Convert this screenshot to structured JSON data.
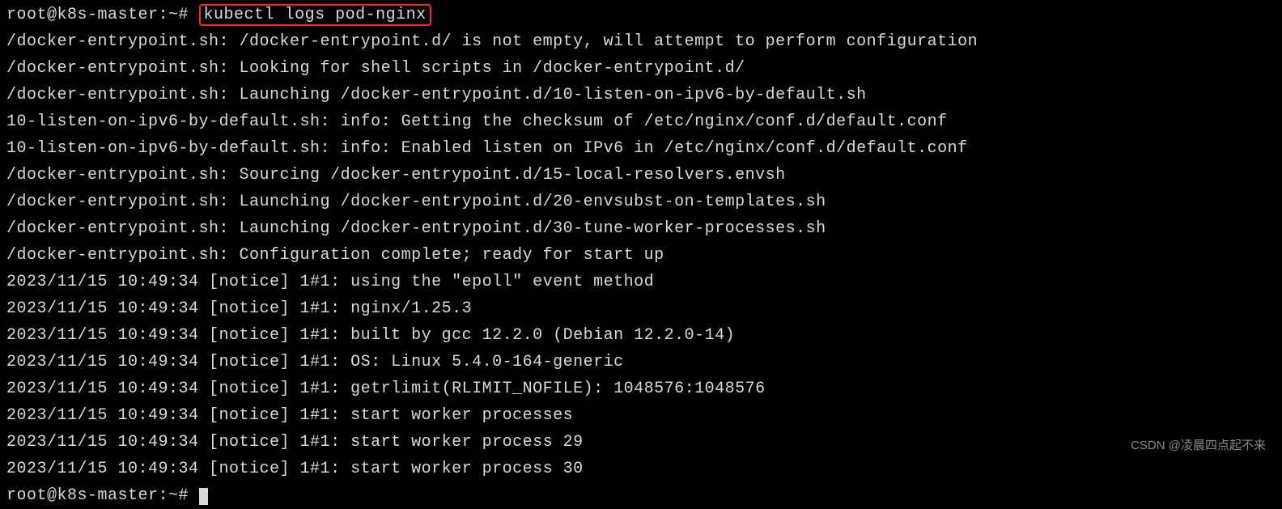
{
  "prompt1": {
    "user_host_path": "root@k8s-master:~# ",
    "command": "kubectl logs pod-nginx"
  },
  "output_lines": [
    "/docker-entrypoint.sh: /docker-entrypoint.d/ is not empty, will attempt to perform configuration",
    "/docker-entrypoint.sh: Looking for shell scripts in /docker-entrypoint.d/",
    "/docker-entrypoint.sh: Launching /docker-entrypoint.d/10-listen-on-ipv6-by-default.sh",
    "10-listen-on-ipv6-by-default.sh: info: Getting the checksum of /etc/nginx/conf.d/default.conf",
    "10-listen-on-ipv6-by-default.sh: info: Enabled listen on IPv6 in /etc/nginx/conf.d/default.conf",
    "/docker-entrypoint.sh: Sourcing /docker-entrypoint.d/15-local-resolvers.envsh",
    "/docker-entrypoint.sh: Launching /docker-entrypoint.d/20-envsubst-on-templates.sh",
    "/docker-entrypoint.sh: Launching /docker-entrypoint.d/30-tune-worker-processes.sh",
    "/docker-entrypoint.sh: Configuration complete; ready for start up",
    "2023/11/15 10:49:34 [notice] 1#1: using the \"epoll\" event method",
    "2023/11/15 10:49:34 [notice] 1#1: nginx/1.25.3",
    "2023/11/15 10:49:34 [notice] 1#1: built by gcc 12.2.0 (Debian 12.2.0-14)",
    "2023/11/15 10:49:34 [notice] 1#1: OS: Linux 5.4.0-164-generic",
    "2023/11/15 10:49:34 [notice] 1#1: getrlimit(RLIMIT_NOFILE): 1048576:1048576",
    "2023/11/15 10:49:34 [notice] 1#1: start worker processes",
    "2023/11/15 10:49:34 [notice] 1#1: start worker process 29",
    "2023/11/15 10:49:34 [notice] 1#1: start worker process 30"
  ],
  "prompt2": {
    "user_host_path": "root@k8s-master:~# "
  },
  "watermark": "CSDN @凌晨四点起不来"
}
